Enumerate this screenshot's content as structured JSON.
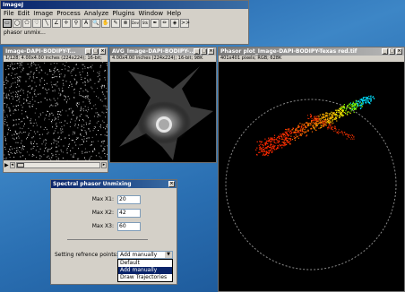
{
  "main_window": {
    "title": "ImageJ",
    "menu": [
      "File",
      "Edit",
      "Image",
      "Process",
      "Analyze",
      "Plugins",
      "Window",
      "Help"
    ],
    "tools": [
      "rectangle",
      "oval",
      "polygon",
      "freehand",
      "line",
      "angle",
      "point",
      "wand",
      "text",
      "zoom",
      "hand",
      "dropper",
      "stop",
      "Dev",
      "Stk",
      "brush",
      "pencil",
      "flood",
      "more"
    ],
    "tools_glyphs": [
      "▭",
      "◯",
      "⬠",
      "♡",
      "╲",
      "∠",
      "✛",
      "⚲",
      "A",
      "🔍",
      "✋",
      "✎",
      "⊗",
      "Dev",
      "Stk",
      "✒",
      "✏",
      "◈",
      ">>"
    ],
    "status": "phasor unmix..."
  },
  "window1": {
    "title": "Image-DAPI-BODIPY-T...",
    "info": "1/128; 4.00x4.00 inches (224x224); 16-bit;"
  },
  "window2": {
    "title": "AVG_Image-DAPI-BODIPY-...",
    "info": "4.00x4.00 inches (224x224); 16-bit; 98K"
  },
  "window3": {
    "title": "Phasor plot_Image-DAPI-BODIPY-Texas red.tif",
    "info": "401x401 pixels; RGB; 628K"
  },
  "dialog": {
    "title": "Spectral phasor Unmixing",
    "fields": [
      {
        "label": "Max X1:",
        "value": "20"
      },
      {
        "label": "Max X2:",
        "value": "42"
      },
      {
        "label": "Max X3:",
        "value": "60"
      }
    ],
    "select_label": "Setting refrence points:",
    "select_value": "Add manually",
    "options": [
      "Default",
      "Add manually",
      "Draw Trajectories"
    ],
    "highlighted_option": "Add manually"
  },
  "colors": {
    "title_active": "#0a246a",
    "highlight": "#0a246a"
  }
}
